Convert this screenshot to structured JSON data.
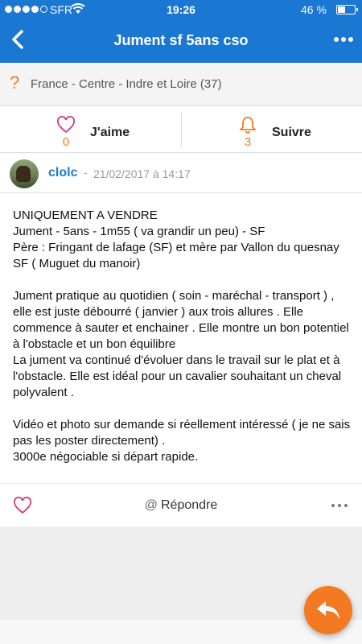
{
  "status_bar": {
    "carrier": "SFR",
    "time": "19:26",
    "battery_percent_text": "46 %",
    "battery_level": 0.46
  },
  "nav": {
    "title": "Jument sf 5ans cso",
    "back_icon": "chevron-left-icon",
    "more_icon": "more-horizontal-icon"
  },
  "location": {
    "icon": "question-mark-icon",
    "text": "France - Centre - Indre et Loire (37)"
  },
  "actions": {
    "like": {
      "label": "J'aime",
      "count": "0",
      "icon": "heart-outline-icon"
    },
    "follow": {
      "label": "Suivre",
      "count": "3",
      "icon": "bell-outline-icon"
    }
  },
  "post": {
    "author": "clolc",
    "separator": "-",
    "date": "21/02/2017 à 14:17",
    "paragraphs": [
      "UNIQUEMENT A VENDRE",
      "Jument - 5ans - 1m55 ( va grandir un peu) - SF",
      "Père : Fringant de lafage (SF) et mère par Vallon du quesnay SF ( Muguet du manoir)",
      "Jument pratique au quotidien ( soin - maréchal - transport ) , elle est juste débourré ( janvier ) aux trois allures . Elle commence à sauter et enchainer . Elle montre un bon potentiel à l'obstacle et un bon équilibre",
      "La jument va continué d'évoluer dans le travail sur le plat et à l'obstacle. Elle est idéal pour un cavalier souhaitant un cheval polyvalent .",
      "Vidéo et photo sur demande si réellement intéressé ( je ne sais pas les poster directement) .",
      "3000e négociable si départ rapide."
    ],
    "footer": {
      "reply_at": "@",
      "reply_label": "Répondre"
    }
  },
  "colors": {
    "brand_blue": "#1a77d2",
    "accent_orange": "#f47a21",
    "like_pink": "#d23a78"
  }
}
